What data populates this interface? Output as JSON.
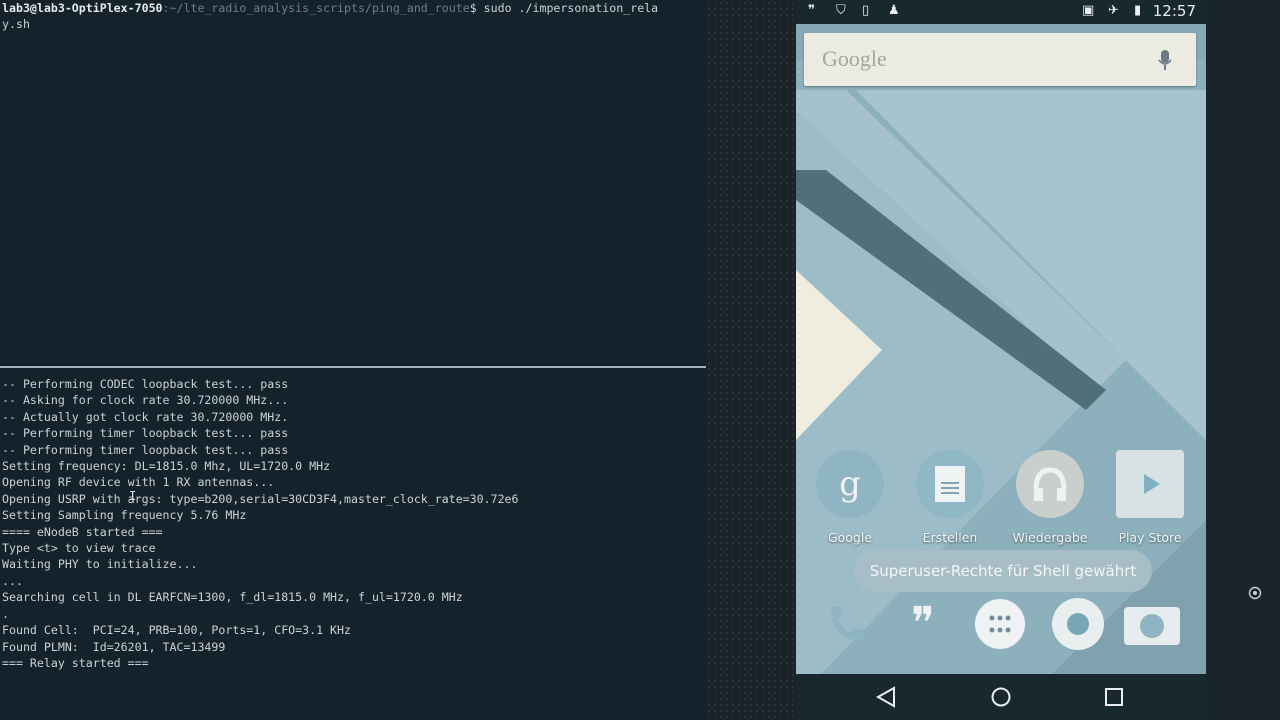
{
  "terminal": {
    "prompt_user": "lab3@lab3-OptiPlex-7050",
    "prompt_path": ":~/lte_radio_analysis_scripts/ping_and_route",
    "command": "$ sudo ./impersonation_rela",
    "command_wrap": "y.sh",
    "output": [
      "-- Performing CODEC loopback test... pass",
      "-- Asking for clock rate 30.720000 MHz...",
      "-- Actually got clock rate 30.720000 MHz.",
      "-- Performing timer loopback test... pass",
      "-- Performing timer loopback test... pass",
      "Setting frequency: DL=1815.0 Mhz, UL=1720.0 MHz",
      "Opening RF device with 1 RX antennas...",
      "Opening USRP with args: type=b200,serial=30CD3F4,master_clock_rate=30.72e6",
      "Setting Sampling frequency 5.76 MHz",
      "",
      "==== eNodeB started ===",
      "Type <t> to view trace",
      "Waiting PHY to initialize...",
      "...",
      "Searching cell in DL EARFCN=1300, f_dl=1815.0 MHz, f_ul=1720.0 MHz",
      ".",
      "Found Cell:  PCI=24, PRB=100, Ports=1, CFO=3.1 KHz",
      "Found PLMN:  Id=26201, TAC=13499",
      "",
      "=== Relay started ==="
    ]
  },
  "phone": {
    "status_time": "12:57",
    "search_placeholder": "Google",
    "apps": [
      {
        "label": "Google",
        "icon": "google-g-icon"
      },
      {
        "label": "Erstellen",
        "icon": "docs-icon"
      },
      {
        "label": "Wiedergabe",
        "icon": "headphones-icon"
      },
      {
        "label": "Play Store",
        "icon": "play-store-icon"
      }
    ],
    "toast": "Superuser-Rechte für Shell gewährt",
    "dock": [
      "phone-icon",
      "hangouts-icon",
      "app-drawer-icon",
      "chrome-icon",
      "camera-icon"
    ],
    "nav": [
      "back-icon",
      "home-icon",
      "recents-icon"
    ]
  },
  "colors": {
    "terminal_bg": "#16222b",
    "terminal_text": "#c9d3d6",
    "phone_wallpaper": "#86a9b7",
    "statusbar": "#19272e"
  }
}
